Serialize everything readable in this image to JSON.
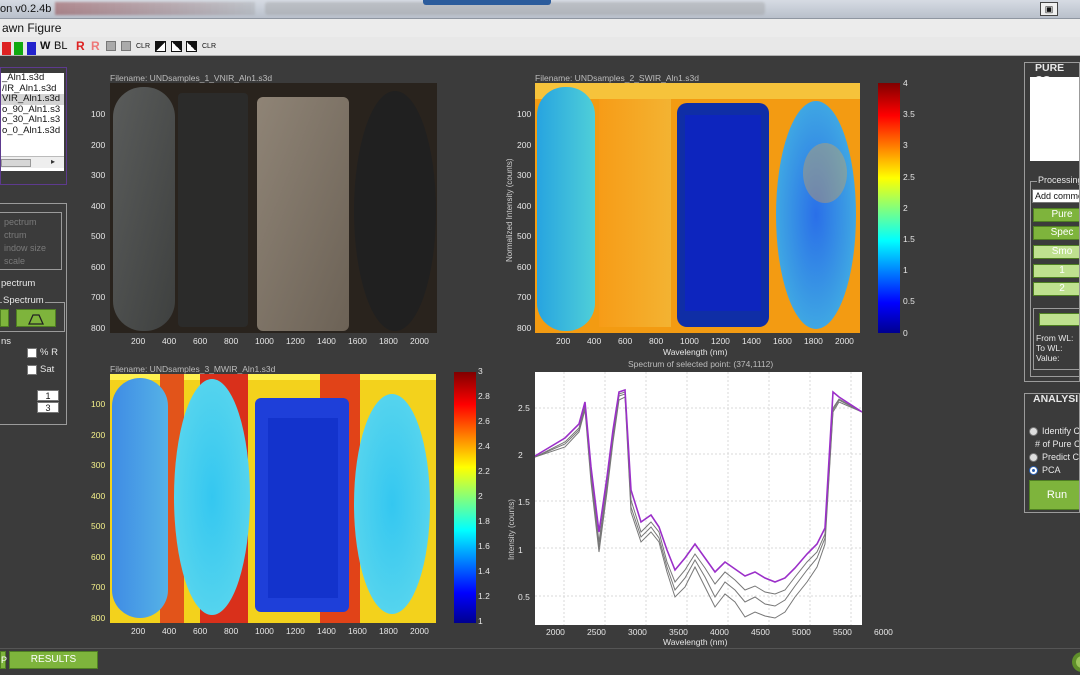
{
  "titlebar": {
    "title": "on v0.2.4b"
  },
  "menubar": {
    "item": "awn Figure"
  },
  "toolbar": {
    "w": "W",
    "bl": "BL",
    "r1": "R",
    "r2": "R",
    "clr1": "CLR",
    "clr2": "CLR"
  },
  "file_list": [
    "_Aln1.s3d",
    "/IR_Aln1.s3d",
    "VIR_Aln1.s3d",
    "o_90_Aln1.s3",
    "o_30_Aln1.s3",
    "o_0_Aln1.s3d"
  ],
  "left_controls": {
    "dim_items": [
      "pectrum",
      "ctrum",
      "indow size",
      "scale"
    ],
    "spectrum": "pectrum",
    "spectrum_group": "Spectrum",
    "ns": "ns",
    "pct_r": "% R",
    "sat": "Sat",
    "num1": "1",
    "num2": "3"
  },
  "plots": {
    "vnir": {
      "title": "Filename: UNDsamples_1_VNIR_Aln1.s3d",
      "xticks": [
        "200",
        "400",
        "600",
        "800",
        "1000",
        "1200",
        "1400",
        "1600",
        "1800",
        "2000"
      ],
      "yticks": [
        "100",
        "200",
        "300",
        "400",
        "500",
        "600",
        "700",
        "800"
      ]
    },
    "swir": {
      "title": "Filename: UNDsamples_2_SWIR_Aln1.s3d",
      "ylabel": "Normalized Intensity (counts)",
      "xlabel": "Wavelength (nm)",
      "xticks": [
        "200",
        "400",
        "600",
        "800",
        "1000",
        "1200",
        "1400",
        "1600",
        "1800",
        "2000"
      ],
      "yticks": [
        "100",
        "200",
        "300",
        "400",
        "500",
        "600",
        "700",
        "800"
      ],
      "colorbar": [
        "4",
        "3.5",
        "3",
        "2.5",
        "2",
        "1.5",
        "1",
        "0.5",
        "0"
      ]
    },
    "mwir": {
      "title": "Filename: UNDsamples_3_MWIR_Aln1.s3d",
      "xticks": [
        "200",
        "400",
        "600",
        "800",
        "1000",
        "1200",
        "1400",
        "1600",
        "1800",
        "2000"
      ],
      "yticks": [
        "100",
        "200",
        "300",
        "400",
        "500",
        "600",
        "700",
        "800"
      ],
      "colorbar": [
        "3",
        "2.8",
        "2.6",
        "2.4",
        "2.2",
        "2",
        "1.8",
        "1.6",
        "1.4",
        "1.2",
        "1"
      ]
    },
    "spectrum": {
      "title": "Spectrum of selected point: (374,1112)",
      "ylabel": "Intensity (counts)",
      "xlabel": "Wavelength (nm)",
      "xticks": [
        "2000",
        "2500",
        "3000",
        "3500",
        "4000",
        "4500",
        "5000",
        "5500",
        "6000"
      ],
      "yticks": [
        "2.5",
        "2",
        "1.5",
        "1",
        "0.5"
      ]
    }
  },
  "right_panel": {
    "pure_title": "PURE CO",
    "processing": "Processing",
    "dropdown": "Add commo",
    "btn1": "Pure",
    "btn2": "Spec",
    "btn3": "Smo",
    "btn4": "1",
    "btn5": "2",
    "from_wl": "From WL:",
    "to_wl": "To WL:",
    "value": "Value:"
  },
  "analysis": {
    "title": "ANALYSI",
    "opt1": "Identify Co",
    "sub1": "# of Pure Co",
    "opt2": "Predict Co",
    "opt3": "PCA",
    "run": "Run"
  },
  "status": {
    "results": "RESULTS",
    "p": "P"
  },
  "colors": {
    "green": "#7eb43c",
    "purple_border": "#5d3a8e",
    "spectrum_purple": "#9b2fc9"
  }
}
